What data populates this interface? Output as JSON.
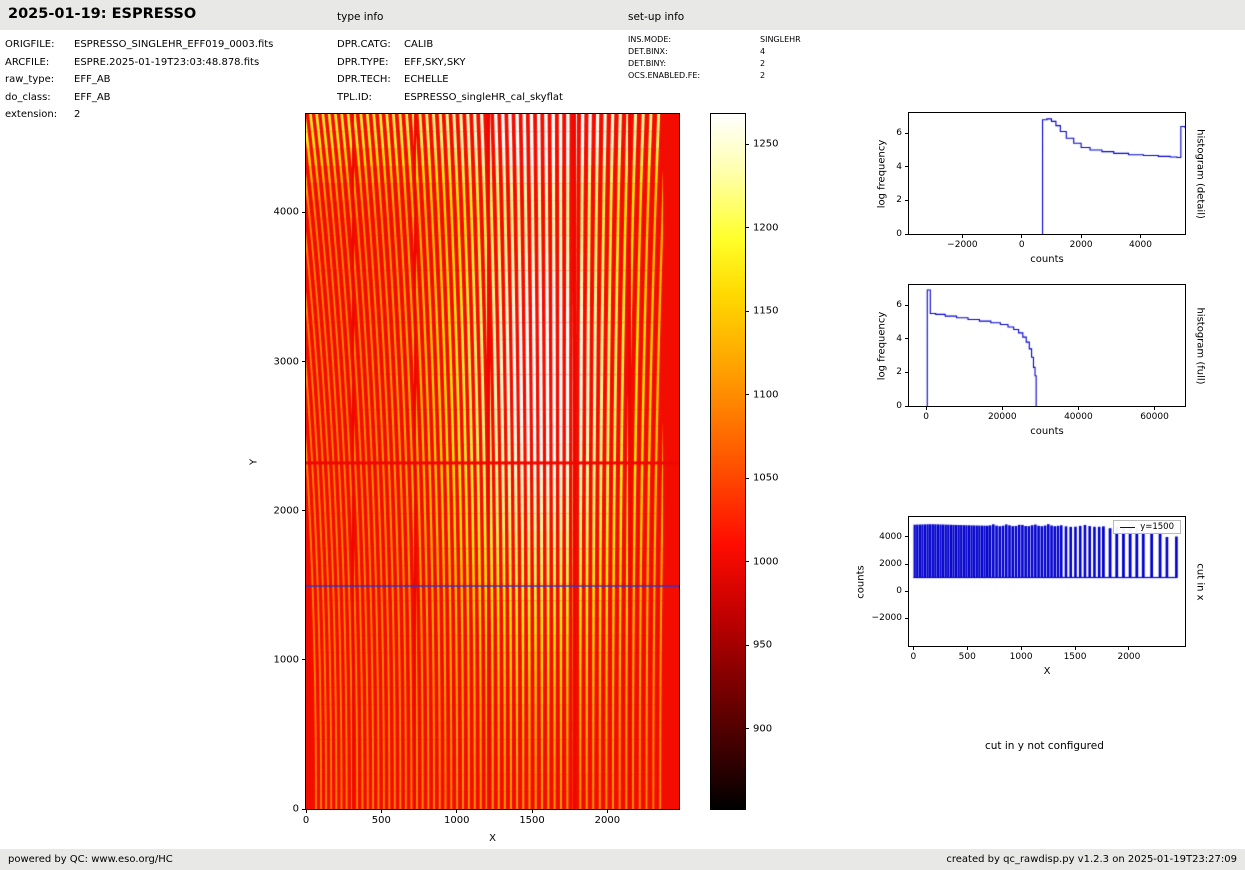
{
  "header": {
    "title": "2025-01-19: ESPRESSO",
    "type_info": "type info",
    "setup_info": "set-up info"
  },
  "file_info": {
    "rows": [
      {
        "label": "ORIGFILE:",
        "value": "ESPRESSO_SINGLEHR_EFF019_0003.fits"
      },
      {
        "label": "ARCFILE:",
        "value": "ESPRE.2025-01-19T23:03:48.878.fits"
      },
      {
        "label": "raw_type:",
        "value": "EFF_AB"
      },
      {
        "label": "do_class:",
        "value": "EFF_AB"
      },
      {
        "label": "extension:",
        "value": "2"
      }
    ]
  },
  "type_info": {
    "rows": [
      {
        "label": "DPR.CATG:",
        "value": "CALIB"
      },
      {
        "label": "DPR.TYPE:",
        "value": "EFF,SKY,SKY"
      },
      {
        "label": "DPR.TECH:",
        "value": "ECHELLE"
      },
      {
        "label": "TPL.ID:",
        "value": "ESPRESSO_singleHR_cal_skyflat"
      }
    ]
  },
  "setup_info": {
    "rows": [
      {
        "label": "INS.MODE:",
        "value": "SINGLEHR"
      },
      {
        "label": "DET.BINX:",
        "value": "4"
      },
      {
        "label": "DET.BINY:",
        "value": "2"
      },
      {
        "label": "OCS.ENABLED.FE:",
        "value": "2"
      }
    ]
  },
  "notes": {
    "cut_y": "cut in y not configured"
  },
  "footer": {
    "left": "powered by QC: www.eso.org/HC",
    "right": "created by qc_rawdisp.py v1.2.3 on 2025-01-19T23:27:09"
  },
  "chart_data": [
    {
      "id": "raw-image",
      "type": "heatmap",
      "description": "ESPRESSO echelle raw sky-flat: many curved vertical orders (hot colormap), bright white-yellow zone upper centre-right, red background; bright detector row near y=2330; several bad red columns; blue cut line at y=1500",
      "xlabel": "X",
      "ylabel": "Y",
      "xlim": [
        0,
        2475
      ],
      "ylim": [
        0,
        4660
      ],
      "xticks": [
        0,
        500,
        1000,
        1500,
        2000
      ],
      "yticks": [
        0,
        1000,
        2000,
        3000,
        4000
      ],
      "colormap": "hot",
      "n_orders": 60,
      "overlay": {
        "cut_line_y": 1500,
        "cut_line_color": "#3333cc",
        "bright_row_y": 2330,
        "bad_columns_x": [
          300,
          710,
          1200,
          1770,
          2140
        ]
      }
    },
    {
      "id": "colorbar",
      "type": "colorbar",
      "colormap": "hot",
      "vmin": 852,
      "vmax": 1268,
      "ticks": [
        900,
        950,
        1000,
        1050,
        1100,
        1150,
        1200,
        1250
      ]
    },
    {
      "id": "histogram-detail",
      "type": "line",
      "step": true,
      "xlabel": "counts",
      "ylabel": "log frequency",
      "right_label": "histogram (detail)",
      "xlim": [
        -3800,
        5500
      ],
      "ylim": [
        0,
        7.2
      ],
      "xticks": [
        -2000,
        0,
        2000,
        4000
      ],
      "yticks": [
        0,
        2,
        4,
        6
      ],
      "color": "#0000cc",
      "x": [
        700,
        850,
        1000,
        1150,
        1300,
        1500,
        1750,
        2000,
        2300,
        2700,
        3100,
        3600,
        4100,
        4600,
        5000,
        5230,
        5360,
        5500
      ],
      "y": [
        6.8,
        6.85,
        6.7,
        6.45,
        6.1,
        5.7,
        5.4,
        5.15,
        5.0,
        4.9,
        4.8,
        4.72,
        4.67,
        4.62,
        4.58,
        4.55,
        6.4,
        6.3
      ]
    },
    {
      "id": "histogram-full",
      "type": "line",
      "step": true,
      "xlabel": "counts",
      "ylabel": "log frequency",
      "right_label": "histogram (full)",
      "xlim": [
        -4500,
        68000
      ],
      "ylim": [
        0,
        7.2
      ],
      "xticks": [
        0,
        20000,
        40000,
        60000
      ],
      "yticks": [
        0,
        2,
        4,
        6
      ],
      "color": "#0000cc",
      "x": [
        300,
        1100,
        2500,
        5000,
        8000,
        11000,
        14000,
        17000,
        19500,
        21500,
        23000,
        24300,
        25400,
        26300,
        27100,
        27700,
        28200,
        28600,
        28900
      ],
      "y": [
        6.9,
        5.5,
        5.45,
        5.35,
        5.25,
        5.15,
        5.05,
        4.95,
        4.85,
        4.7,
        4.55,
        4.35,
        4.1,
        3.8,
        3.4,
        2.9,
        2.3,
        1.8,
        0
      ]
    },
    {
      "id": "cut-in-x",
      "type": "spikes",
      "xlabel": "X",
      "ylabel": "counts",
      "right_label": "cut in x",
      "legend": "y=1500",
      "xlim": [
        -40,
        2520
      ],
      "ylim": [
        -4070,
        5480
      ],
      "xticks": [
        0,
        500,
        1000,
        1500,
        2000
      ],
      "yticks": [
        -2000,
        0,
        2000,
        4000
      ],
      "color": "#0000cc",
      "baseline": 1000,
      "x_extent": [
        0,
        2450
      ],
      "groups": [
        {
          "x0": 2,
          "x1": 700,
          "period": 24,
          "duty": 0.88,
          "peak": 4950
        },
        {
          "x0": 700,
          "x1": 1360,
          "period": 30,
          "duty": 0.8,
          "peak": 4950
        },
        {
          "x0": 1360,
          "x1": 1750,
          "period": 44,
          "duty": 0.55,
          "peak": 4900
        },
        {
          "x0": 1750,
          "x1": 2120,
          "period": 62,
          "duty": 0.42,
          "peak": 4800
        },
        {
          "x0": 2120,
          "x1": 2340,
          "period": 78,
          "duty": 0.33,
          "peak": 4550
        },
        {
          "x0": 2340,
          "x1": 2450,
          "period": 88,
          "duty": 0.28,
          "peak": 4100
        }
      ]
    }
  ]
}
